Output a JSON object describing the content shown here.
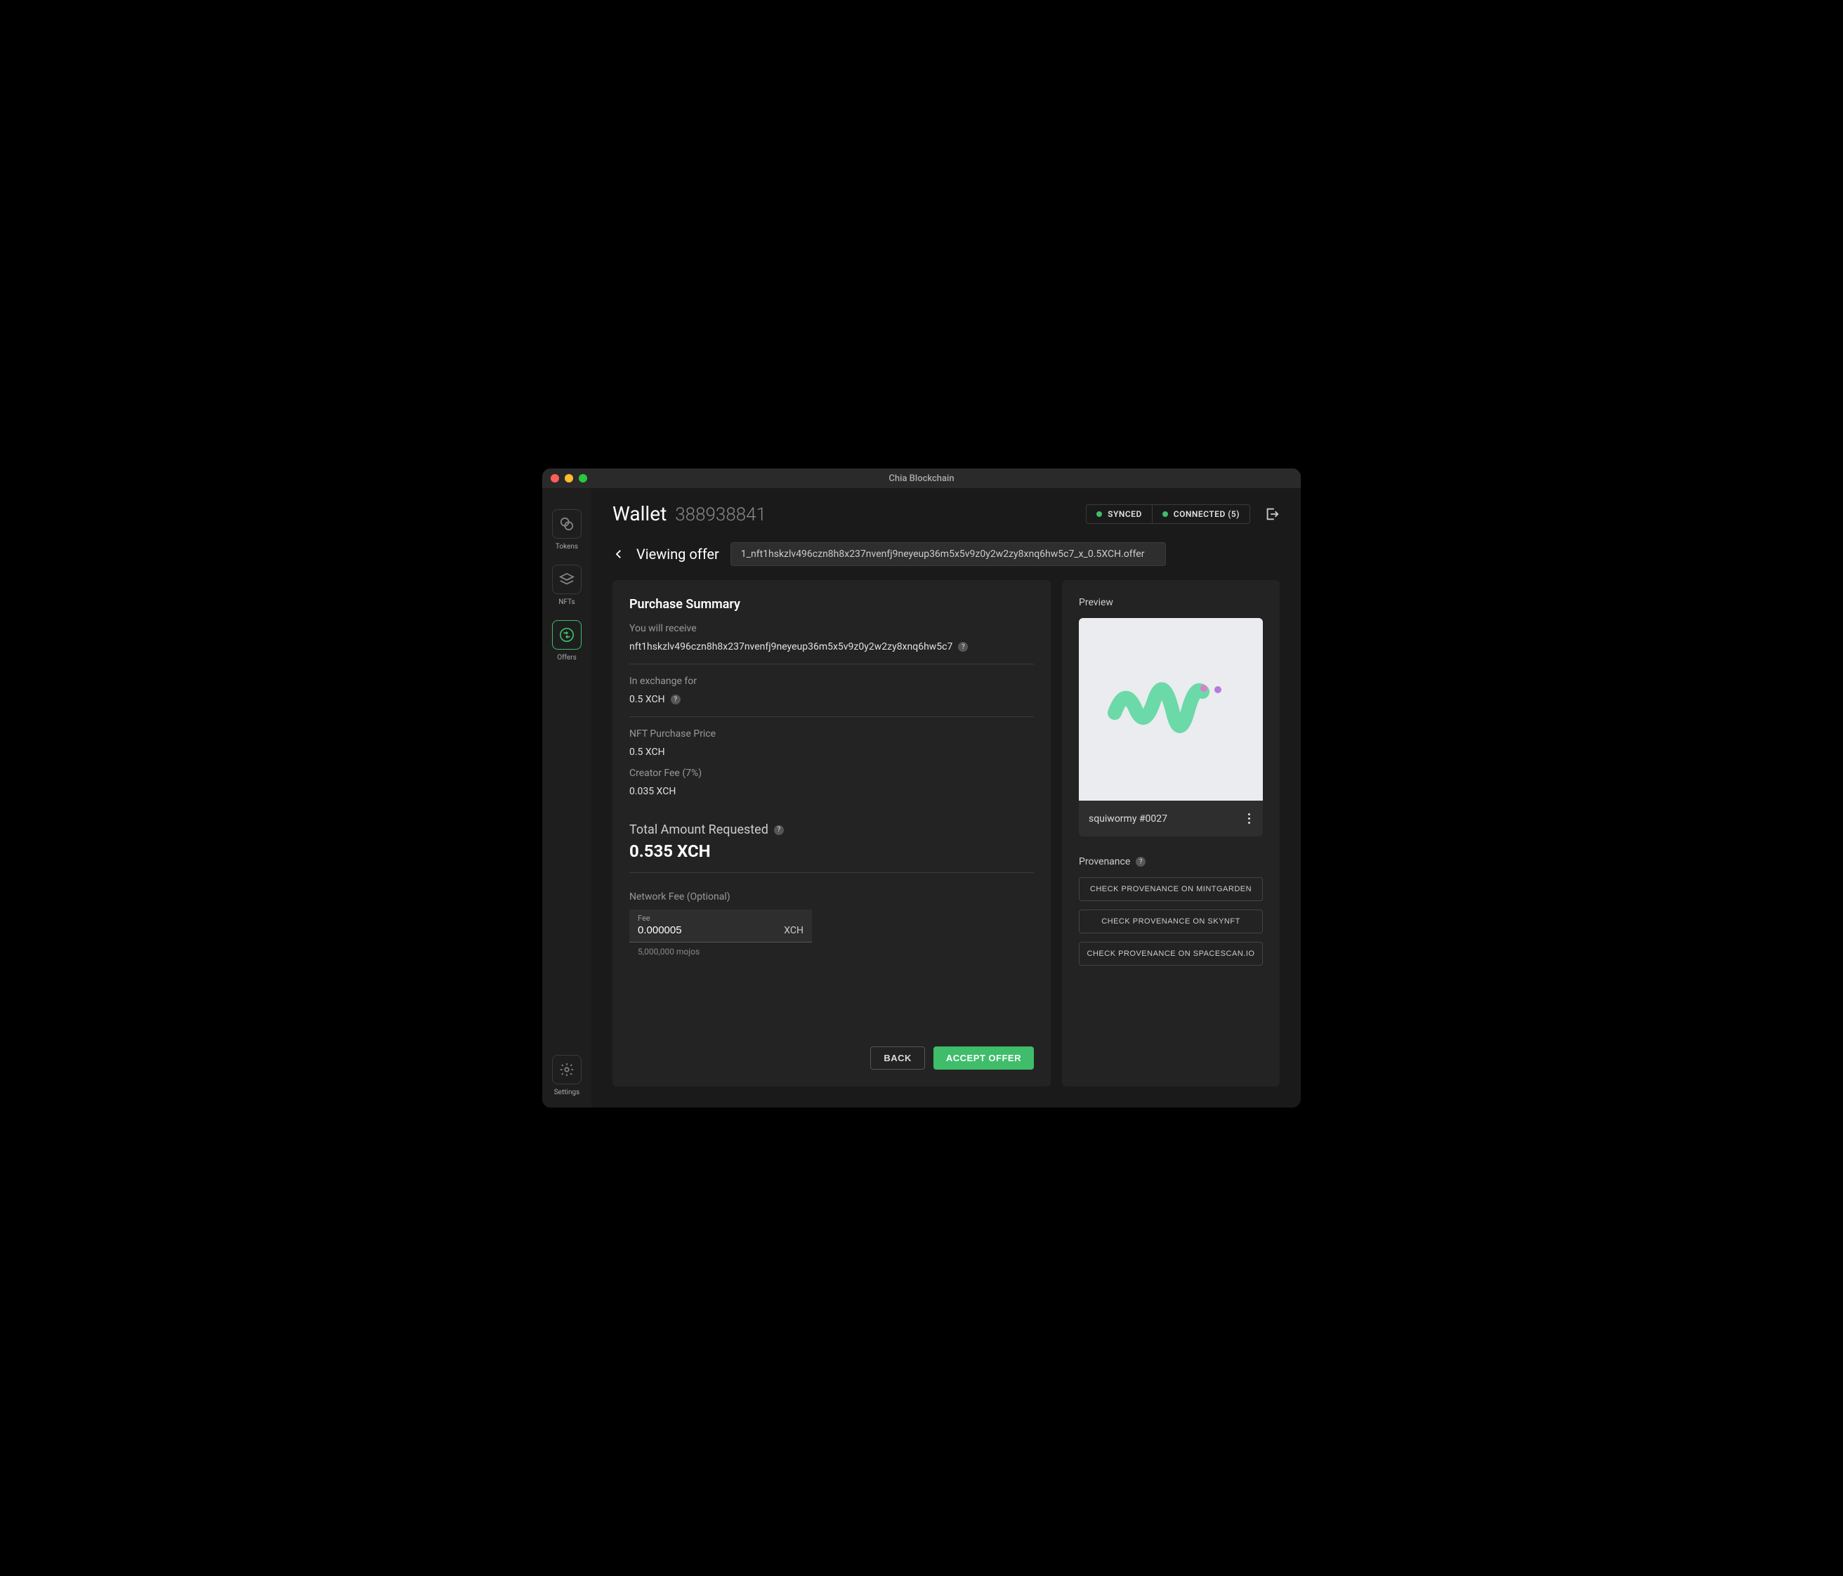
{
  "window_title": "Chia Blockchain",
  "sidebar": {
    "tokens": "Tokens",
    "nfts": "NFTs",
    "offers": "Offers",
    "settings": "Settings"
  },
  "header": {
    "title": "Wallet",
    "wallet_id": "388938841",
    "synced": "SYNCED",
    "connected": "CONNECTED (5)"
  },
  "breadcrumb": {
    "title": "Viewing offer",
    "file": "1_nft1hskzlv496czn8h8x237nvenfj9neyeup36m5x5v9z0y2w2zy8xnq6hw5c7_x_0.5XCH.offer"
  },
  "summary": {
    "title": "Purchase Summary",
    "receive_label": "You will receive",
    "receive_value": "nft1hskzlv496czn8h8x237nvenfj9neyeup36m5x5v9z0y2w2zy8xnq6hw5c7",
    "exchange_label": "In exchange for",
    "exchange_value": "0.5 XCH",
    "price_label": "NFT Purchase Price",
    "price_value": "0.5 XCH",
    "creator_fee_label": "Creator Fee (7%)",
    "creator_fee_value": "0.035 XCH",
    "total_label": "Total Amount Requested",
    "total_value": "0.535 XCH",
    "network_fee_label": "Network Fee (Optional)",
    "fee_field_label": "Fee",
    "fee_value": "0.000005",
    "fee_unit": "XCH",
    "fee_helper": "5,000,000  mojos",
    "back_btn": "BACK",
    "accept_btn": "ACCEPT OFFER"
  },
  "preview": {
    "label": "Preview",
    "nft_name": "squiwormy #0027"
  },
  "provenance": {
    "label": "Provenance",
    "mintgarden": "CHECK PROVENANCE ON MINTGARDEN",
    "skynft": "CHECK PROVENANCE ON SKYNFT",
    "spacescan": "CHECK PROVENANCE ON SPACESCAN.IO"
  }
}
